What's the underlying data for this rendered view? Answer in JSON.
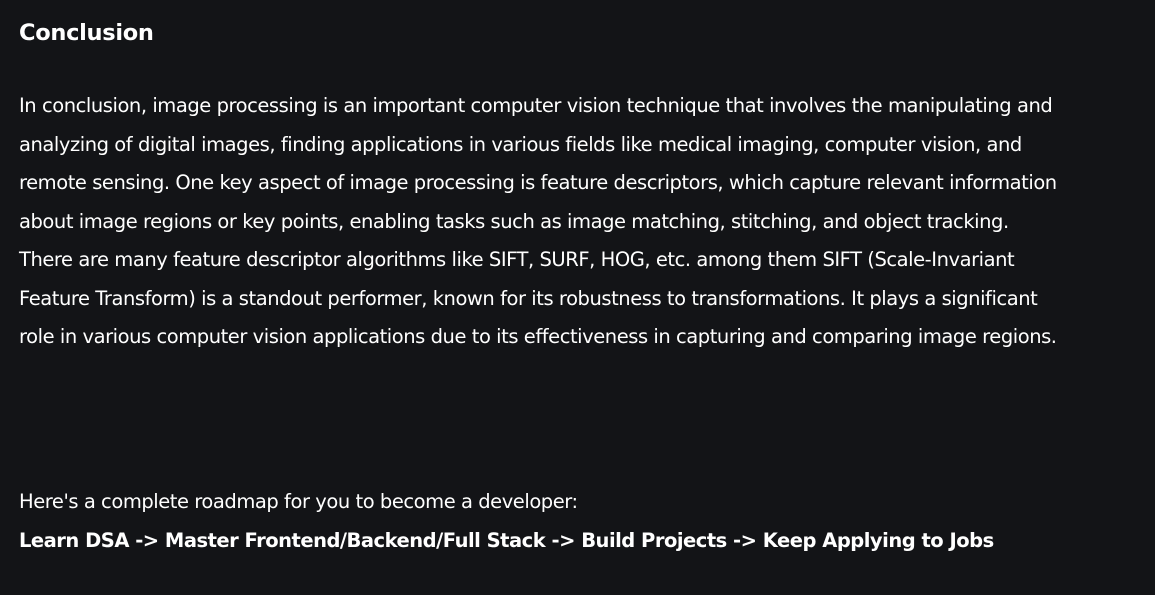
{
  "article": {
    "heading": "Conclusion",
    "paragraph": "In conclusion, image processing is an important computer vision technique that involves the manipulating and analyzing of digital images, finding applications in various fields like medical imaging, computer vision, and remote sensing. One key aspect of image processing is feature descriptors, which capture relevant information about image regions or key points, enabling tasks such as image matching, stitching, and object tracking. There are many feature descriptor algorithms like SIFT, SURF, HOG, etc. among them SIFT (Scale-Invariant Feature Transform) is a standout performer, known for its robustness to transformations. It plays a significant role in various computer vision applications due to its effectiveness in capturing and comparing image regions.",
    "roadmap_intro": "Here's a complete roadmap for you to become a developer:",
    "roadmap_path": "Learn DSA -> Master Frontend/Backend/Full Stack -> Build Projects -> Keep Applying to Jobs"
  },
  "colors": {
    "background": "#131417",
    "text": "#ffffff"
  }
}
